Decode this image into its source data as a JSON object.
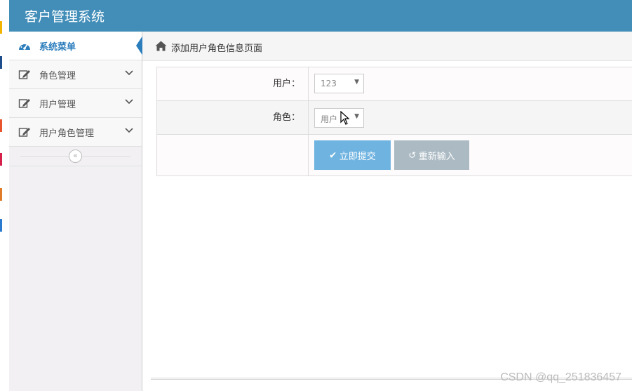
{
  "app": {
    "title": "客户管理系统"
  },
  "sidebar": {
    "items": [
      {
        "label": "系统菜单",
        "icon": "dashboard-icon",
        "active": true
      },
      {
        "label": "角色管理",
        "icon": "edit-icon"
      },
      {
        "label": "用户管理",
        "icon": "edit-icon"
      },
      {
        "label": "用户角色管理",
        "icon": "edit-icon"
      }
    ],
    "collapse_glyph": "«"
  },
  "breadcrumb": {
    "text": "添加用户角色信息页面",
    "icon": "home-icon"
  },
  "form": {
    "user_label": "用户：",
    "user_value": "123",
    "role_label": "角色：",
    "role_value": "用户",
    "submit_label": "立即提交",
    "reset_label": "重新输入"
  },
  "watermark": "CSDN @qq_251836457",
  "colors": {
    "navbar": "#438eb9",
    "submit": "#6fb3e0",
    "reset": "#abbac3",
    "active_text": "#2b7dbc"
  }
}
